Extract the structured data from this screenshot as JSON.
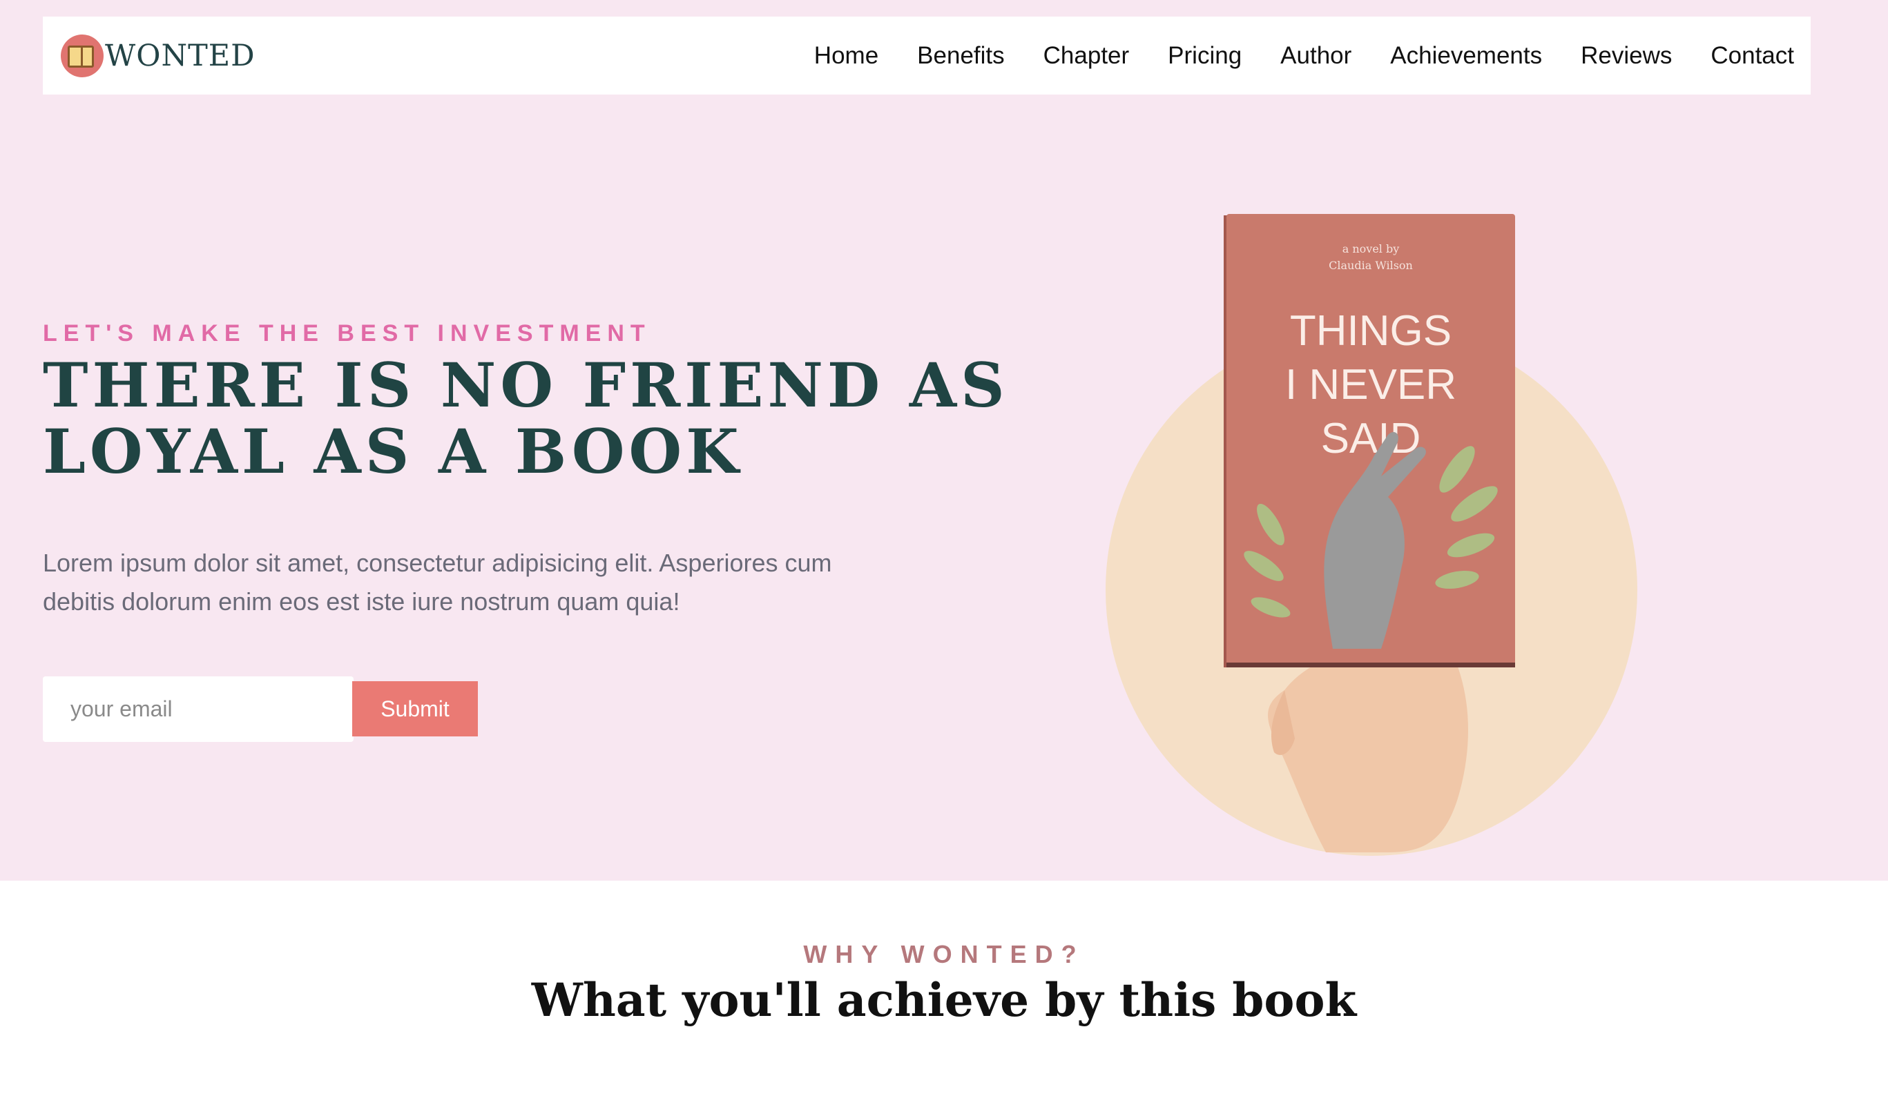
{
  "brand": {
    "name": "WONTED"
  },
  "nav": {
    "items": [
      "Home",
      "Benefits",
      "Chapter",
      "Pricing",
      "Author",
      "Achievements",
      "Reviews",
      "Contact"
    ]
  },
  "hero": {
    "eyebrow": "LET'S MAKE THE BEST INVESTMENT",
    "title_line1": "THERE IS NO FRIEND AS",
    "title_line2": "LOYAL AS A BOOK",
    "description": "Lorem ipsum dolor sit amet, consectetur adipisicing elit. Asperiores cum debitis dolorum enim eos est iste iure nostrum quam quia!",
    "email_placeholder": "your email",
    "submit_label": "Submit"
  },
  "book": {
    "byline_1": "a novel by",
    "byline_2": "Claudia Wilson",
    "title_1": "THINGS",
    "title_2": "I NEVER",
    "title_3": "SAID"
  },
  "why": {
    "eyebrow": "WHY WONTED?",
    "title": "What you'll achieve by this book"
  },
  "colors": {
    "hero_bg": "#f8e7f1",
    "accent_pink": "#e16aa6",
    "heading_green": "#204443",
    "button": "#ea7a74",
    "book_cover": "#c97a6c",
    "circle": "#f5dfc6",
    "why_eyebrow": "#b5787c"
  },
  "icons": {
    "logo": "book-logo-icon"
  }
}
